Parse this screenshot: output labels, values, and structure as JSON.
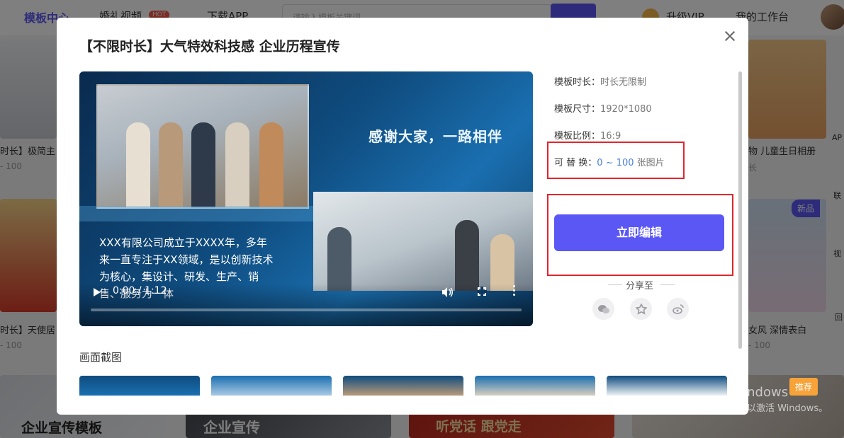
{
  "background": {
    "header": {
      "logo": "模板中心",
      "nav_video": "婚礼视频",
      "nav_badge": "HOT",
      "nav_download": "下载APP",
      "search_placeholder": "请输入模板关键词",
      "vip": "升级VIP",
      "workspace": "我的工作台"
    },
    "cards": [
      {
        "title": "时长】极简主",
        "meta": "- 100"
      },
      {
        "title": "时长】天使居",
        "meta": "- 100"
      },
      {
        "title": "物 儿童生日相册",
        "meta": "长"
      },
      {
        "title": "女风 深情表白",
        "meta": "- 100"
      }
    ],
    "bottom_banners": [
      "企业宣传模板",
      "企业宣传",
      "听党话 跟党走"
    ],
    "right_rail": [
      "AP",
      "联",
      "视",
      "回"
    ],
    "badge_new": "新品",
    "badge_recommend": "推荐",
    "watermark_line1": "激活 Windows",
    "watermark_line2": "转到\"设置\"以激活 Windows。"
  },
  "modal": {
    "title": "【不限时长】大气特效科技感 企业历程宣传",
    "close_icon": "close-icon",
    "video": {
      "tagline": "感谢大家，一路相伴",
      "description": "XXX有限公司成立于XXXX年，多年来一直专注于XX领域，是以创新技术为核心，集设计、研发、生产、销售、服务为一体",
      "time": "0:00 / 1:12",
      "progress": 0.0
    },
    "info": {
      "duration_label": "模板时长：",
      "duration_value": "时长无限制",
      "size_label": "模板尺寸：",
      "size_value": "1920*1080",
      "ratio_label": "模板比例：",
      "ratio_value": "16:9",
      "replace_label": "可 替 换：",
      "replace_range": "0 ~ 100",
      "replace_unit": " 张图片"
    },
    "edit_button": "立即编辑",
    "share_label": "分享至",
    "share_icons": [
      "wechat-icon",
      "star-icon",
      "weibo-icon"
    ],
    "screenshots_label": "画面截图",
    "screenshot_count": 5
  },
  "colors": {
    "accent": "#5b57f5",
    "highlight": "#e0262c",
    "link": "#4a7fd8"
  }
}
